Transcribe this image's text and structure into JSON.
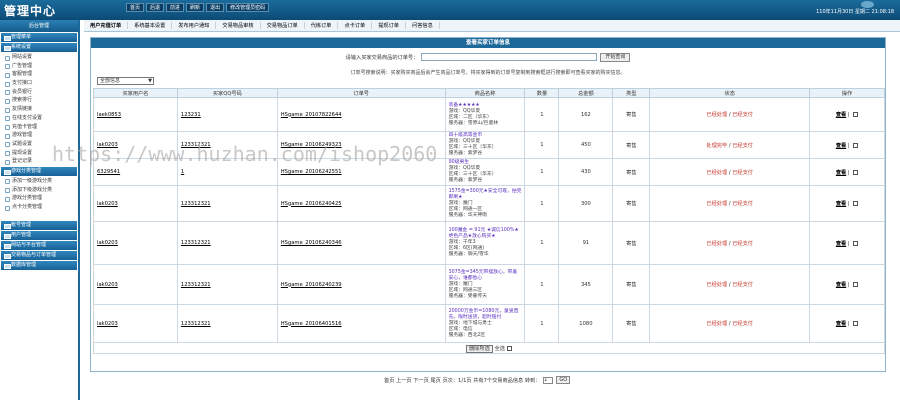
{
  "header": {
    "logo": "管理中心",
    "nav": [
      "首页",
      "后退",
      "前进",
      "刷新",
      "退出",
      "修改管理员密码"
    ],
    "datetime": "110年11月30日 星期二 21:08:18"
  },
  "subnav": [
    "用户充值订单",
    "系统基本设置",
    "发布用户通知",
    "交易物品审核",
    "交易物品订单",
    "代练订单",
    "点卡订单",
    "提现订单",
    "问答信息"
  ],
  "sidebar": {
    "top": "后台管理",
    "groups": [
      {
        "label": "管理菜单",
        "items": []
      },
      {
        "label": "系统设置",
        "items": [
          "网站设置",
          "广告管理",
          "客服管理",
          "支付接口",
          "会员银行",
          "搜索排行",
          "友情链接",
          "在线支付设置",
          "充值卡管理",
          "游戏管理",
          "试题设置",
          "提现设置",
          "登记记录"
        ]
      },
      {
        "label": "游戏分类管理",
        "items": [
          "添加一级游戏分类",
          "添加下级游戏分类",
          "游戏分类管理",
          "点卡分类管理"
        ]
      },
      {
        "label": "帐号管理",
        "items": []
      },
      {
        "label": "用户管理",
        "items": []
      },
      {
        "label": "网站与平台管理",
        "items": []
      },
      {
        "label": "交易物品与订单管理",
        "items": []
      },
      {
        "label": "数据库管理",
        "items": []
      }
    ]
  },
  "main": {
    "title": "查看买家订单信息",
    "search_label": "请输入买家交易商品的订单号：",
    "search_value": "",
    "search_button": "开始查询",
    "note": "订单号搜索说明：买家购买商品后会产生商品订单号。将买家得到的订单号复制到搜索框进行搜索即可查看买家的购买信息。",
    "filter": "全部信息",
    "columns": [
      "买家用户名",
      "买家QQ号码",
      "订单号",
      "商品名称",
      "数量",
      "总金额",
      "类型",
      "状态",
      "操作"
    ],
    "rows": [
      {
        "user": "laek0853",
        "qq": "123231",
        "order": "HSgame_20107822644",
        "goods_title": "装备★★★★★",
        "goods_lines": [
          "游戏：QQ华夏",
          "区域：二区（华东）",
          "服务器：雪原山/巨鹿林"
        ],
        "qty": "1",
        "amount": "162",
        "type": "寄售",
        "status_a": "已经处理",
        "status_b": "已经支付",
        "op": "查看"
      },
      {
        "user": "lak0203",
        "qq": "123312321",
        "order": "HSgame_20106249323",
        "goods_title": "四十级高等金币",
        "goods_lines": [
          "游戏：QQ华夏",
          "区域：三十区（华东）",
          "服务器：紫梦谷"
        ],
        "qty": "1",
        "amount": "450",
        "type": "寄售",
        "status_a": "处理完毕",
        "status_b": "已经支付",
        "op": "查看"
      },
      {
        "user": "6329541",
        "qq": "1",
        "order": "HSgame_20106242551",
        "goods_title": "90级男生",
        "goods_lines": [
          "游戏：QQ华夏",
          "区域：三十区（华东）",
          "服务器：紫梦谷"
        ],
        "qty": "1",
        "amount": "430",
        "type": "寄售",
        "status_a": "已经处理",
        "status_b": "已经支付",
        "op": "查看"
      },
      {
        "user": "lak0203",
        "qq": "123312321",
        "order": "HSgame_20106240425",
        "goods_title": "1575金=300元★安全可靠，拍完即刷★",
        "goods_lines": [
          "游戏：魔门",
          "区域：网通一区",
          "服务器：华天神雨"
        ],
        "qty": "1",
        "amount": "300",
        "type": "寄售",
        "status_a": "已经处理",
        "status_b": "已经支付",
        "op": "查看"
      },
      {
        "user": "lak0203",
        "qq": "123312321",
        "order": "HSgame_20106240346",
        "goods_title": "100魔金 = 91元 ★诚信100%★绝色产品★放心购买★",
        "goods_lines": [
          "游戏：千年3",
          "区域：6区(网通)",
          "服务器：御天/雪华"
        ],
        "qty": "1",
        "amount": "91",
        "type": "寄售",
        "status_a": "已经处理",
        "status_b": "已经支付",
        "op": "查看"
      },
      {
        "user": "lak0203",
        "qq": "123312321",
        "order": "HSgame_20106240239",
        "goods_title": "3075金=345元带摆放心，带着安心，谁都愁心",
        "goods_lines": [
          "游戏：魔门",
          "区域：网通三区",
          "服务器：受雇传天"
        ],
        "qty": "1",
        "amount": "345",
        "type": "寄售",
        "status_a": "已经处理",
        "status_b": "已经支付",
        "op": "查看"
      },
      {
        "user": "lak0203",
        "qq": "123312321",
        "order": "HSgame_20106401516",
        "goods_title": "20000万金币=1080元，童叟直先。限时送货，超时赔付",
        "goods_lines": [
          "游戏：地下城与勇士",
          "区域：电信",
          "服务器：西北2区"
        ],
        "qty": "1",
        "amount": "1080",
        "type": "寄售",
        "status_a": "已经处理",
        "status_b": "已经支付",
        "op": "查看"
      }
    ],
    "batch_button": "删除所选",
    "batch_label": "全选",
    "pager_text": "首页 上一页 下一页 尾页 页次：1/1页 共有7个交易商品信息 转到：",
    "pager_input": "1",
    "pager_go": "GO"
  },
  "watermark": "https://www.huzhan.com/ishop2060"
}
